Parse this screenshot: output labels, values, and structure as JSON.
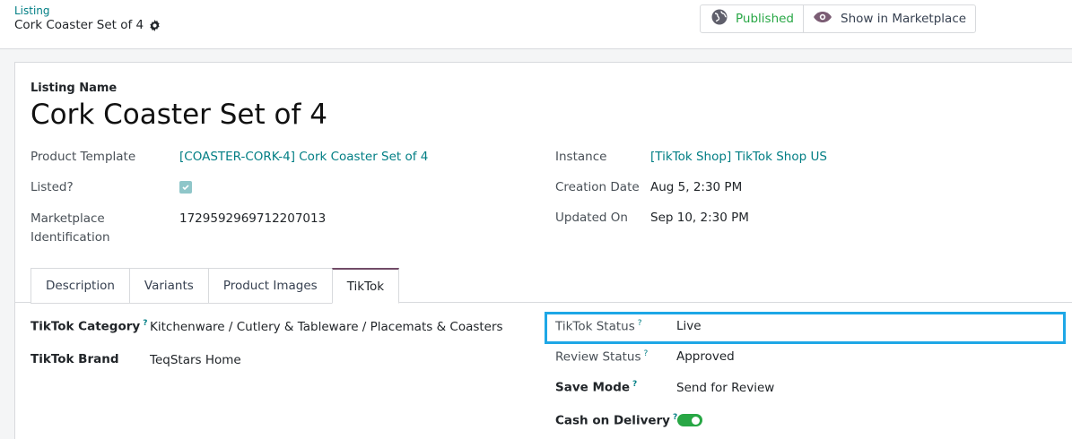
{
  "breadcrumb": {
    "parent": "Listing",
    "current": "Cork Coaster Set of 4"
  },
  "smart_buttons": {
    "published": "Published",
    "show_marketplace": "Show in Marketplace"
  },
  "form": {
    "name_label": "Listing Name",
    "name": "Cork Coaster Set of 4",
    "product_template_label": "Product Template",
    "product_template": "[COASTER-CORK-4] Cork Coaster Set of 4",
    "listed_label": "Listed?",
    "listed": true,
    "marketplace_id_label_1": "Marketplace",
    "marketplace_id_label_2": "Identification",
    "marketplace_id": "1729592969712207013",
    "instance_label": "Instance",
    "instance": "[TikTok Shop] TikTok Shop US",
    "creation_date_label": "Creation Date",
    "creation_date": "Aug 5, 2:30 PM",
    "updated_on_label": "Updated On",
    "updated_on": "Sep 10, 2:30 PM"
  },
  "tabs": [
    "Description",
    "Variants",
    "Product Images",
    "TikTok"
  ],
  "active_tab": "TikTok",
  "tiktok": {
    "category_label": "TikTok Category",
    "category": "Kitchenware / Cutlery & Tableware / Placemats & Coasters",
    "brand_label": "TikTok Brand",
    "brand": "TeqStars Home",
    "status_label": "TikTok Status",
    "status": "Live",
    "review_status_label": "Review Status",
    "review_status": "Approved",
    "save_mode_label": "Save Mode",
    "save_mode": "Send for Review",
    "cod_label": "Cash on Delivery",
    "cod_enabled": true,
    "help_mark": "?"
  },
  "colors": {
    "link": "#017e84",
    "published": "#28a745",
    "tab_active": "#714b67",
    "highlight": "#1ea7e6"
  }
}
